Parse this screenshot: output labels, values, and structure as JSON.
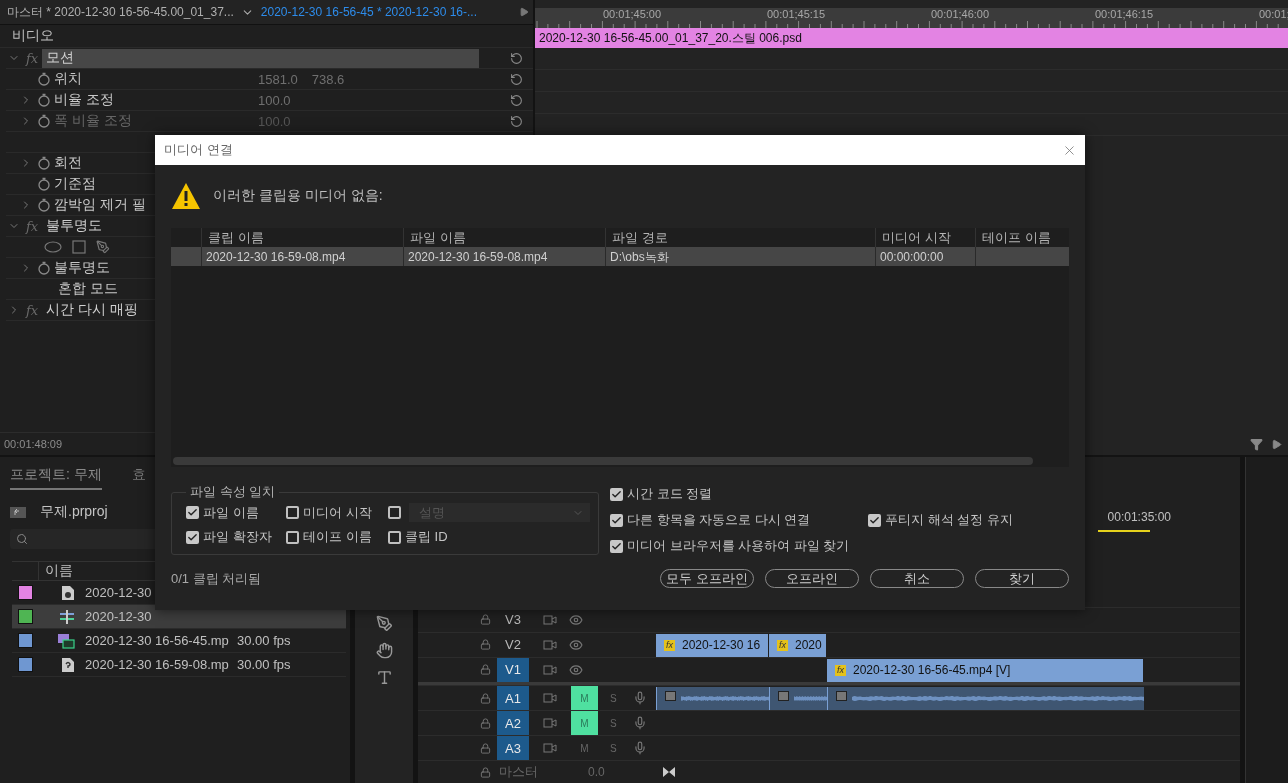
{
  "effect_controls": {
    "tabs": [
      {
        "label": "마스터 * 2020-12-30 16-56-45.00_01_37...",
        "selected": false
      },
      {
        "label": "2020-12-30 16-56-45 * 2020-12-30 16-...",
        "selected": true
      }
    ],
    "section": "비디오",
    "rows": [
      {
        "kind": "group",
        "badge": "fx",
        "label": "모션",
        "expanded": true,
        "selected": true,
        "resettable": true
      },
      {
        "kind": "param",
        "label": "위치",
        "values": [
          "1581.0",
          "738.6"
        ],
        "expandable": false,
        "disabled": false,
        "resettable": true
      },
      {
        "kind": "param",
        "label": "비율 조정",
        "values": [
          "100.0"
        ],
        "expandable": true,
        "disabled": false,
        "resettable": true
      },
      {
        "kind": "param",
        "label": "폭 비율 조정",
        "values": [
          "100.0"
        ],
        "expandable": true,
        "disabled": true,
        "resettable": true
      },
      {
        "kind": "blank"
      },
      {
        "kind": "param",
        "label": "회전",
        "expandable": true,
        "disabled": false,
        "resettable": false
      },
      {
        "kind": "param",
        "label": "기준점",
        "expandable": false,
        "disabled": false,
        "resettable": false
      },
      {
        "kind": "param",
        "label": "깜박임 제거 필",
        "expandable": true,
        "disabled": false,
        "resettable": false
      },
      {
        "kind": "group",
        "badge": "fx",
        "label": "불투명도",
        "expanded": true,
        "selected": false,
        "resettable": false
      },
      {
        "kind": "mask_tools"
      },
      {
        "kind": "param",
        "label": "불투명도",
        "expandable": true,
        "disabled": false,
        "resettable": false
      },
      {
        "kind": "plain",
        "label": "혼합 모드"
      },
      {
        "kind": "group",
        "badge": "fx",
        "label": "시간 다시 매핑",
        "expanded": false,
        "selected": false,
        "resettable": false
      }
    ],
    "timecode": "00:01:48:09"
  },
  "source_timeline": {
    "ruler": [
      "00:01;45:00",
      "00:01;45:15",
      "00:01;46:00",
      "00:01;46:15",
      "00:01;"
    ],
    "clip": {
      "label": "2020-12-30 16-56-45.00_01_37_20.스틸 006.psd",
      "color": "#e383e3"
    }
  },
  "project": {
    "tabs": [
      {
        "label": "프로젝트: 무제",
        "selected": true
      },
      {
        "label": "효",
        "selected": false
      }
    ],
    "file": "무제.prproj",
    "column": "이름",
    "items": [
      {
        "color": "#e383e3",
        "kind": "still",
        "name": "2020-12-30",
        "selected": false
      },
      {
        "color": "#4fb553",
        "kind": "sequence",
        "name": "2020-12-30",
        "selected": true
      },
      {
        "color": "#6f97d1",
        "kind": "video",
        "name": "2020-12-30 16-56-45.mp",
        "fps": "30.00 fps",
        "selected": false
      },
      {
        "color": "#6f97d1",
        "kind": "missing",
        "name": "2020-12-30 16-59-08.mp",
        "fps": "30.00 fps",
        "selected": false
      }
    ]
  },
  "timeline": {
    "timecode": "00:01:35:00",
    "tracks": [
      {
        "name": "V3",
        "kind": "video",
        "targeted": false
      },
      {
        "name": "V2",
        "kind": "video",
        "targeted": false,
        "clips": [
          {
            "kind": "video",
            "label": "2020-12-30 16",
            "badge": "fx"
          },
          {
            "kind": "video",
            "label": "2020",
            "badge": "fx"
          }
        ]
      },
      {
        "name": "V1",
        "kind": "video",
        "targeted": true,
        "clips": [
          {
            "kind": "video",
            "label": "2020-12-30 16-56-45.mp4 [V]",
            "badge": "fx"
          }
        ]
      },
      {
        "name": "A1",
        "kind": "audio",
        "targeted": true,
        "muted": true,
        "mute_label": "M",
        "solo_label": "S",
        "clips": [
          {
            "kind": "audio"
          },
          {
            "kind": "audio"
          },
          {
            "kind": "audio"
          }
        ]
      },
      {
        "name": "A2",
        "kind": "audio",
        "targeted": true,
        "muted": true,
        "mute_label": "M",
        "solo_label": "S"
      },
      {
        "name": "A3",
        "kind": "audio",
        "targeted": true,
        "muted": false,
        "mute_label": "M",
        "solo_label": "S"
      }
    ],
    "master": {
      "label": "마스터",
      "value": "0.0"
    }
  },
  "dialog": {
    "title": "미디어 연결",
    "message": "이러한 클립용 미디어 없음:",
    "columns": [
      "클립 이름",
      "파일 이름",
      "파일 경로",
      "미디어 시작",
      "테이프 이름"
    ],
    "rows": [
      {
        "cells": [
          "2020-12-30 16-59-08.mp4",
          "2020-12-30 16-59-08.mp4",
          "D:\\obs녹화",
          "00:00:00:00"
        ],
        "selected": true
      }
    ],
    "match": {
      "title": "파일 속성 일치",
      "options": [
        {
          "kind": "checkbox",
          "label": "파일 이름",
          "checked": true
        },
        {
          "kind": "checkbox",
          "label": "미디어 시작",
          "checked": false
        },
        {
          "kind": "select",
          "checked": false,
          "placeholder": "설명",
          "disabled": true
        },
        {
          "kind": "checkbox",
          "label": "파일 확장자",
          "checked": true
        },
        {
          "kind": "checkbox",
          "label": "테이프 이름",
          "checked": false
        },
        {
          "kind": "checkbox",
          "label": "클립 ID",
          "checked": false
        }
      ]
    },
    "options": [
      {
        "label": "시간 코드 정렬",
        "checked": true
      },
      {
        "label": "다른 항목을 자동으로 다시 연결",
        "checked": true
      },
      {
        "label": "푸티지 해석 설정 유지",
        "checked": true
      },
      {
        "label": "미디어 브라우저를 사용하여 파일 찾기",
        "checked": true
      }
    ],
    "status": "0/1 클립 처리됨",
    "buttons": [
      "모두 오프라인",
      "오프라인",
      "취소",
      "찾기"
    ]
  }
}
